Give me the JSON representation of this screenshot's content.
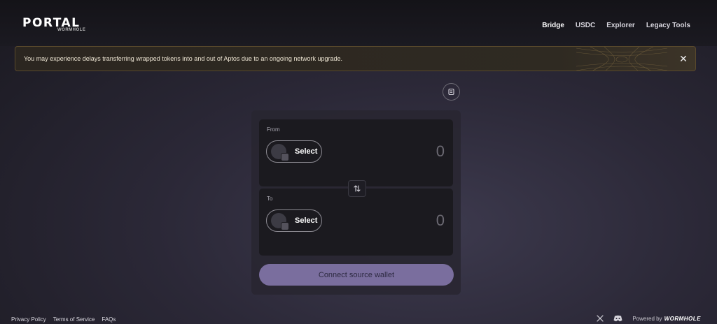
{
  "header": {
    "logo_main": "PORTAL",
    "logo_sub": "WORMHOLE",
    "nav": [
      {
        "label": "Bridge",
        "active": true
      },
      {
        "label": "USDC",
        "active": false
      },
      {
        "label": "Explorer",
        "active": false
      },
      {
        "label": "Legacy Tools",
        "active": false
      }
    ]
  },
  "banner": {
    "text": "You may experience delays transferring wrapped tokens into and out of Aptos due to an ongoing network upgrade."
  },
  "bridge": {
    "from": {
      "label": "From",
      "select_label": "Select",
      "amount": "0"
    },
    "to": {
      "label": "To",
      "select_label": "Select",
      "amount": "0"
    },
    "connect_label": "Connect source wallet"
  },
  "footer": {
    "links": [
      "Privacy Policy",
      "Terms of Service",
      "FAQs"
    ],
    "powered_by": "Powered by",
    "powered_brand": "WORMHOLE"
  },
  "colors": {
    "accent": "#7a6e9e",
    "banner_border": "#5a4a2c"
  },
  "icons": [
    "settings-icon",
    "swap-arrows-icon",
    "close-icon",
    "x-logo-icon",
    "discord-icon"
  ]
}
